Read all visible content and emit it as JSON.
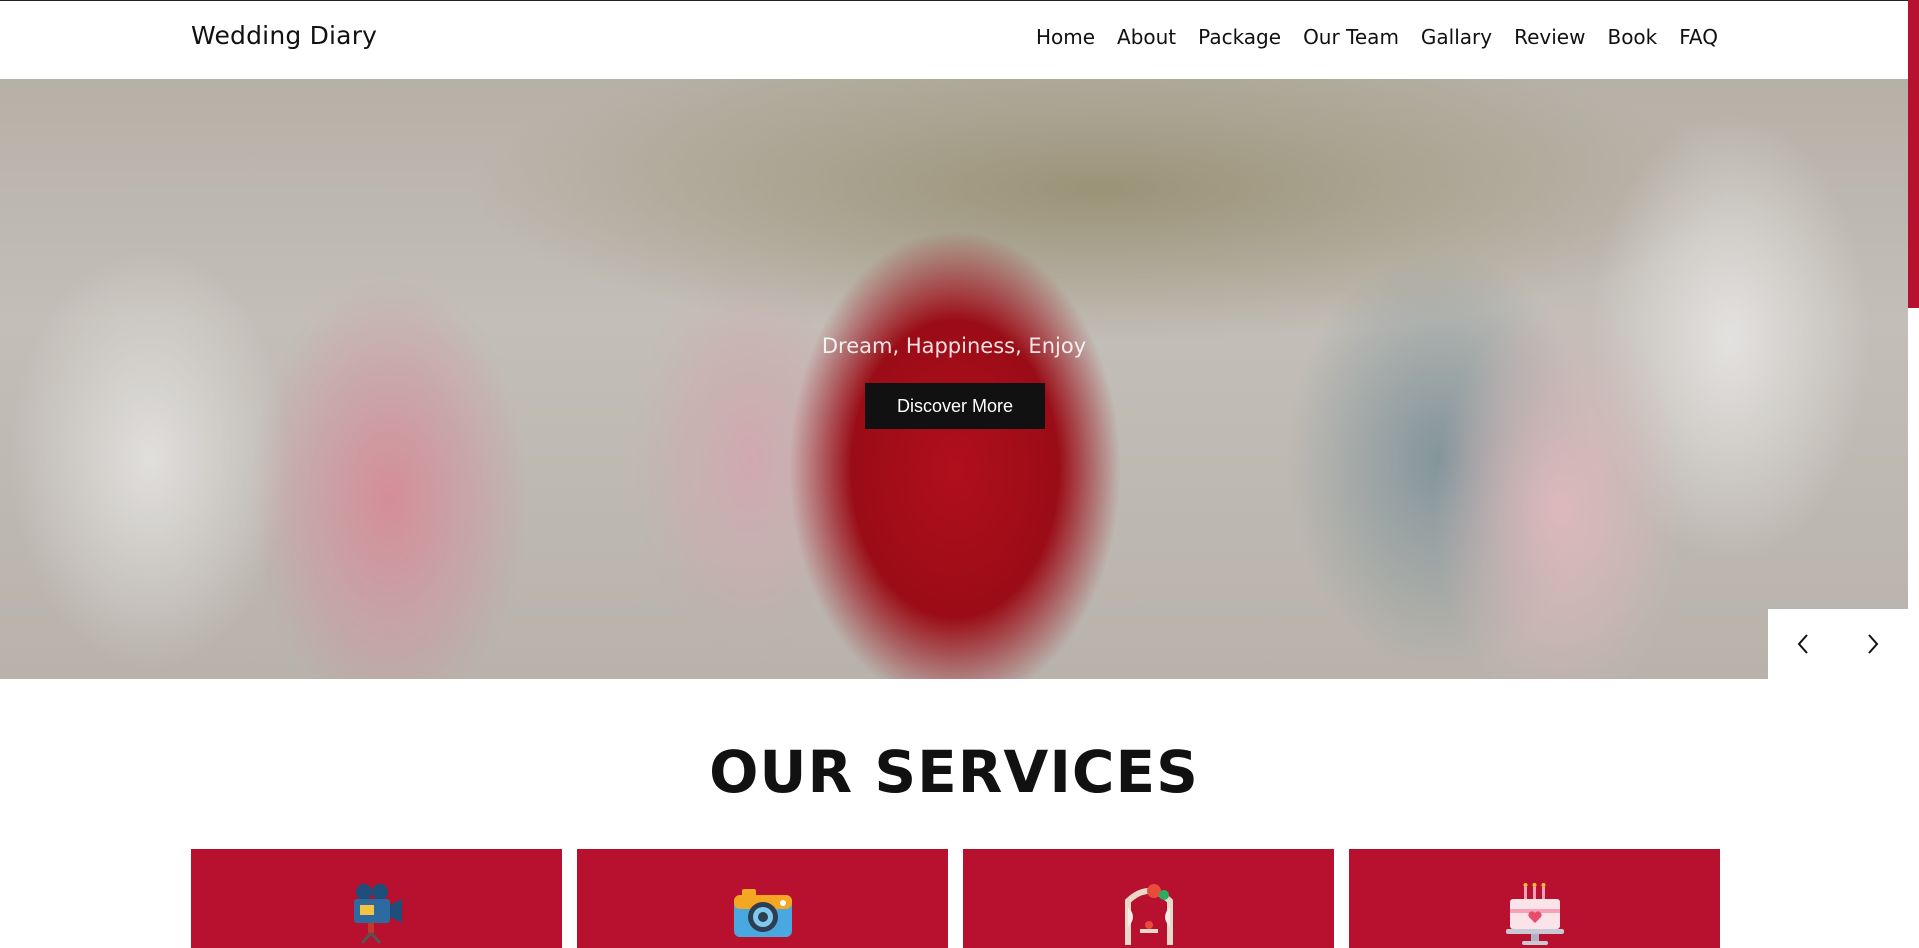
{
  "brand": {
    "name": "Wedding Diary"
  },
  "nav": {
    "items": [
      "Home",
      "About",
      "Package",
      "Our Team",
      "Gallary",
      "Review",
      "Book",
      "FAQ"
    ]
  },
  "hero": {
    "tagline": "Dream, Happiness, Enjoy",
    "button_label": "Discover More",
    "prev_icon": "chevron-left-icon",
    "next_icon": "chevron-right-icon"
  },
  "services": {
    "title": "OUR SERVICES",
    "cards": [
      {
        "icon": "video-camera-icon"
      },
      {
        "icon": "photo-camera-icon"
      },
      {
        "icon": "wedding-arch-icon"
      },
      {
        "icon": "wedding-cake-icon"
      }
    ]
  },
  "colors": {
    "accent": "#b8102f",
    "button_bg": "#111111",
    "text": "#111111"
  }
}
